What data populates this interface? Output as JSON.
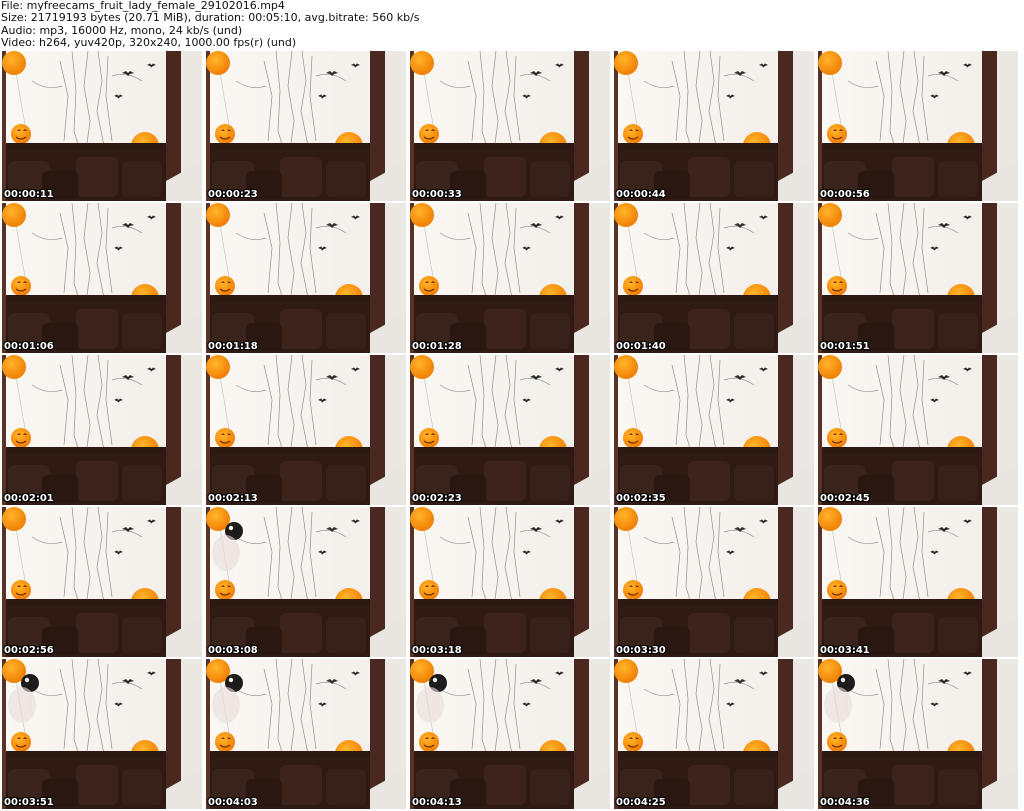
{
  "header": {
    "file_line": "File: myfreecams_fruit_lady_female_29102016.mp4",
    "size_line": "Size: 21719193 bytes (20.71 MiB), duration: 00:05:10, avg.bitrate: 560 kb/s",
    "audio_line": "Audio: mp3, 16000 Hz, mono, 24 kb/s (und)",
    "video_line": "Video: h264, yuv420p, 320x240, 1000.00 fps(r) (und)"
  },
  "thumbnails": [
    {
      "timestamp": "00:00:11",
      "dark_balloon": false
    },
    {
      "timestamp": "00:00:23",
      "dark_balloon": false
    },
    {
      "timestamp": "00:00:33",
      "dark_balloon": false
    },
    {
      "timestamp": "00:00:44",
      "dark_balloon": false
    },
    {
      "timestamp": "00:00:56",
      "dark_balloon": false
    },
    {
      "timestamp": "00:01:06",
      "dark_balloon": false
    },
    {
      "timestamp": "00:01:18",
      "dark_balloon": false
    },
    {
      "timestamp": "00:01:28",
      "dark_balloon": false
    },
    {
      "timestamp": "00:01:40",
      "dark_balloon": false
    },
    {
      "timestamp": "00:01:51",
      "dark_balloon": false
    },
    {
      "timestamp": "00:02:01",
      "dark_balloon": false
    },
    {
      "timestamp": "00:02:13",
      "dark_balloon": false
    },
    {
      "timestamp": "00:02:23",
      "dark_balloon": false
    },
    {
      "timestamp": "00:02:35",
      "dark_balloon": false
    },
    {
      "timestamp": "00:02:45",
      "dark_balloon": false
    },
    {
      "timestamp": "00:02:56",
      "dark_balloon": false
    },
    {
      "timestamp": "00:03:08",
      "dark_balloon": true
    },
    {
      "timestamp": "00:03:18",
      "dark_balloon": false
    },
    {
      "timestamp": "00:03:30",
      "dark_balloon": false
    },
    {
      "timestamp": "00:03:41",
      "dark_balloon": false
    },
    {
      "timestamp": "00:03:51",
      "dark_balloon": true
    },
    {
      "timestamp": "00:04:03",
      "dark_balloon": true
    },
    {
      "timestamp": "00:04:13",
      "dark_balloon": true
    },
    {
      "timestamp": "00:04:25",
      "dark_balloon": false
    },
    {
      "timestamp": "00:04:36",
      "dark_balloon": true
    }
  ]
}
